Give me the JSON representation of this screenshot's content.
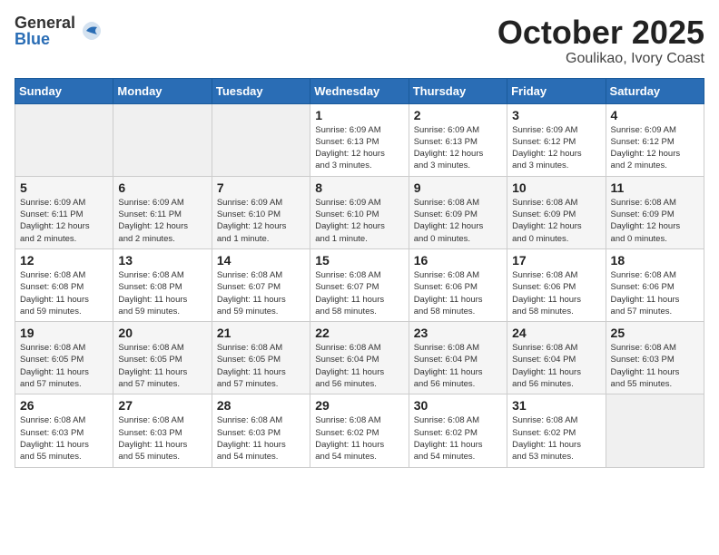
{
  "header": {
    "logo_general": "General",
    "logo_blue": "Blue",
    "month_title": "October 2025",
    "location": "Goulikao, Ivory Coast"
  },
  "weekdays": [
    "Sunday",
    "Monday",
    "Tuesday",
    "Wednesday",
    "Thursday",
    "Friday",
    "Saturday"
  ],
  "weeks": [
    [
      {
        "day": "",
        "info": ""
      },
      {
        "day": "",
        "info": ""
      },
      {
        "day": "",
        "info": ""
      },
      {
        "day": "1",
        "info": "Sunrise: 6:09 AM\nSunset: 6:13 PM\nDaylight: 12 hours\nand 3 minutes."
      },
      {
        "day": "2",
        "info": "Sunrise: 6:09 AM\nSunset: 6:13 PM\nDaylight: 12 hours\nand 3 minutes."
      },
      {
        "day": "3",
        "info": "Sunrise: 6:09 AM\nSunset: 6:12 PM\nDaylight: 12 hours\nand 3 minutes."
      },
      {
        "day": "4",
        "info": "Sunrise: 6:09 AM\nSunset: 6:12 PM\nDaylight: 12 hours\nand 2 minutes."
      }
    ],
    [
      {
        "day": "5",
        "info": "Sunrise: 6:09 AM\nSunset: 6:11 PM\nDaylight: 12 hours\nand 2 minutes."
      },
      {
        "day": "6",
        "info": "Sunrise: 6:09 AM\nSunset: 6:11 PM\nDaylight: 12 hours\nand 2 minutes."
      },
      {
        "day": "7",
        "info": "Sunrise: 6:09 AM\nSunset: 6:10 PM\nDaylight: 12 hours\nand 1 minute."
      },
      {
        "day": "8",
        "info": "Sunrise: 6:09 AM\nSunset: 6:10 PM\nDaylight: 12 hours\nand 1 minute."
      },
      {
        "day": "9",
        "info": "Sunrise: 6:08 AM\nSunset: 6:09 PM\nDaylight: 12 hours\nand 0 minutes."
      },
      {
        "day": "10",
        "info": "Sunrise: 6:08 AM\nSunset: 6:09 PM\nDaylight: 12 hours\nand 0 minutes."
      },
      {
        "day": "11",
        "info": "Sunrise: 6:08 AM\nSunset: 6:09 PM\nDaylight: 12 hours\nand 0 minutes."
      }
    ],
    [
      {
        "day": "12",
        "info": "Sunrise: 6:08 AM\nSunset: 6:08 PM\nDaylight: 11 hours\nand 59 minutes."
      },
      {
        "day": "13",
        "info": "Sunrise: 6:08 AM\nSunset: 6:08 PM\nDaylight: 11 hours\nand 59 minutes."
      },
      {
        "day": "14",
        "info": "Sunrise: 6:08 AM\nSunset: 6:07 PM\nDaylight: 11 hours\nand 59 minutes."
      },
      {
        "day": "15",
        "info": "Sunrise: 6:08 AM\nSunset: 6:07 PM\nDaylight: 11 hours\nand 58 minutes."
      },
      {
        "day": "16",
        "info": "Sunrise: 6:08 AM\nSunset: 6:06 PM\nDaylight: 11 hours\nand 58 minutes."
      },
      {
        "day": "17",
        "info": "Sunrise: 6:08 AM\nSunset: 6:06 PM\nDaylight: 11 hours\nand 58 minutes."
      },
      {
        "day": "18",
        "info": "Sunrise: 6:08 AM\nSunset: 6:06 PM\nDaylight: 11 hours\nand 57 minutes."
      }
    ],
    [
      {
        "day": "19",
        "info": "Sunrise: 6:08 AM\nSunset: 6:05 PM\nDaylight: 11 hours\nand 57 minutes."
      },
      {
        "day": "20",
        "info": "Sunrise: 6:08 AM\nSunset: 6:05 PM\nDaylight: 11 hours\nand 57 minutes."
      },
      {
        "day": "21",
        "info": "Sunrise: 6:08 AM\nSunset: 6:05 PM\nDaylight: 11 hours\nand 57 minutes."
      },
      {
        "day": "22",
        "info": "Sunrise: 6:08 AM\nSunset: 6:04 PM\nDaylight: 11 hours\nand 56 minutes."
      },
      {
        "day": "23",
        "info": "Sunrise: 6:08 AM\nSunset: 6:04 PM\nDaylight: 11 hours\nand 56 minutes."
      },
      {
        "day": "24",
        "info": "Sunrise: 6:08 AM\nSunset: 6:04 PM\nDaylight: 11 hours\nand 56 minutes."
      },
      {
        "day": "25",
        "info": "Sunrise: 6:08 AM\nSunset: 6:03 PM\nDaylight: 11 hours\nand 55 minutes."
      }
    ],
    [
      {
        "day": "26",
        "info": "Sunrise: 6:08 AM\nSunset: 6:03 PM\nDaylight: 11 hours\nand 55 minutes."
      },
      {
        "day": "27",
        "info": "Sunrise: 6:08 AM\nSunset: 6:03 PM\nDaylight: 11 hours\nand 55 minutes."
      },
      {
        "day": "28",
        "info": "Sunrise: 6:08 AM\nSunset: 6:03 PM\nDaylight: 11 hours\nand 54 minutes."
      },
      {
        "day": "29",
        "info": "Sunrise: 6:08 AM\nSunset: 6:02 PM\nDaylight: 11 hours\nand 54 minutes."
      },
      {
        "day": "30",
        "info": "Sunrise: 6:08 AM\nSunset: 6:02 PM\nDaylight: 11 hours\nand 54 minutes."
      },
      {
        "day": "31",
        "info": "Sunrise: 6:08 AM\nSunset: 6:02 PM\nDaylight: 11 hours\nand 53 minutes."
      },
      {
        "day": "",
        "info": ""
      }
    ]
  ]
}
